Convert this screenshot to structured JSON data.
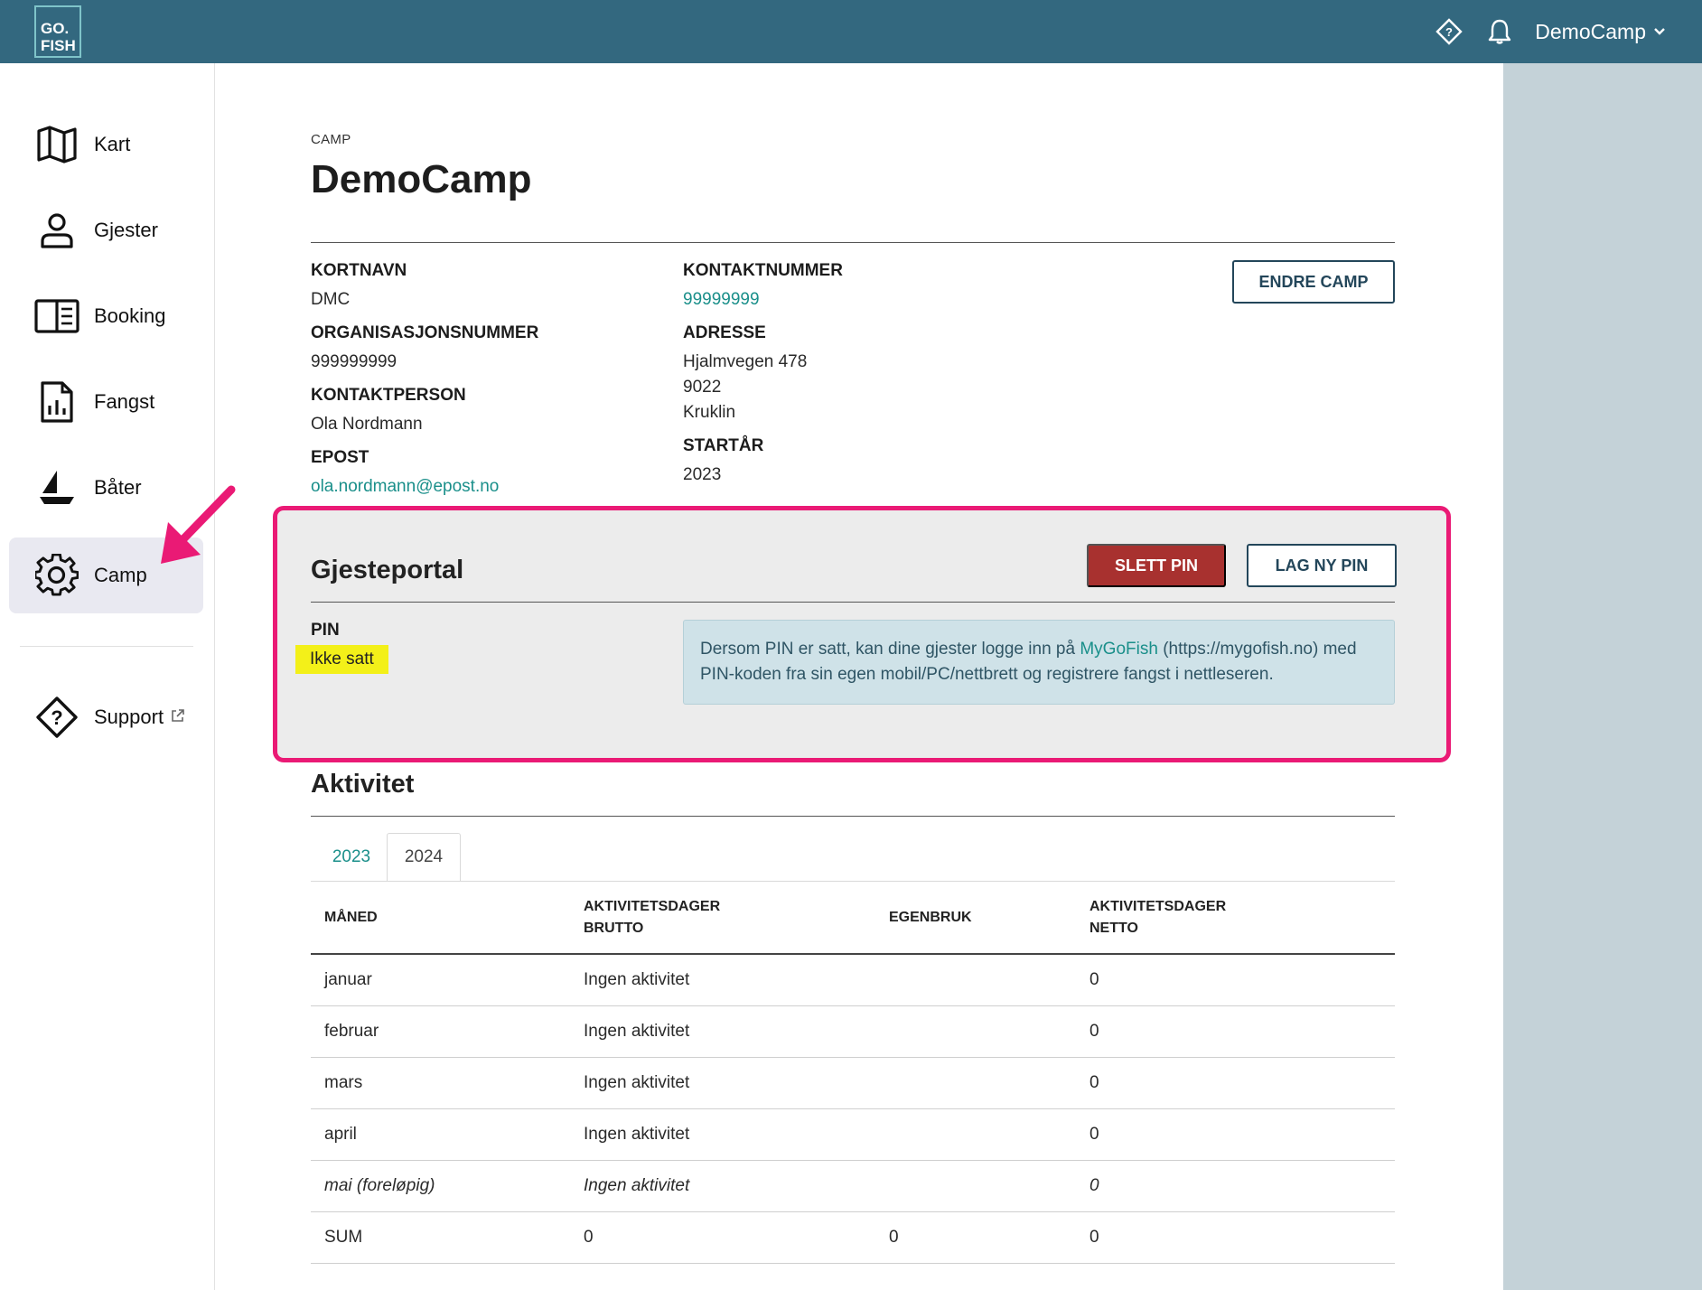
{
  "brand": {
    "logo_line1": "GO.",
    "logo_line2": "FISH"
  },
  "topbar": {
    "user_name": "DemoCamp",
    "support_icon": "diamond-question-icon",
    "bell_icon": "bell-icon",
    "chevron_icon": "chevron-down-icon"
  },
  "sidebar": {
    "items": [
      {
        "label": "Kart",
        "icon": "map-icon"
      },
      {
        "label": "Gjester",
        "icon": "person-icon"
      },
      {
        "label": "Booking",
        "icon": "book-icon"
      },
      {
        "label": "Fangst",
        "icon": "report-chart-icon"
      },
      {
        "label": "Båter",
        "icon": "boat-icon"
      },
      {
        "label": "Camp",
        "icon": "gear-icon",
        "active": true
      }
    ],
    "support": {
      "label": "Support",
      "icon": "diamond-question-icon",
      "external_icon": "external-link-icon"
    }
  },
  "page": {
    "eyebrow": "CAMP",
    "title": "DemoCamp"
  },
  "camp_info": {
    "kortnavn_label": "KORTNAVN",
    "kortnavn": "DMC",
    "orgnr_label": "ORGANISASJONSNUMMER",
    "orgnr": "999999999",
    "kontaktperson_label": "KONTAKTPERSON",
    "kontaktperson": "Ola Nordmann",
    "epost_label": "EPOST",
    "epost": "ola.nordmann@epost.no",
    "kontaktnummer_label": "KONTAKTNUMMER",
    "kontaktnummer": "99999999",
    "adresse_label": "ADRESSE",
    "adresse_line1": "Hjalmvegen 478",
    "adresse_line2": "9022",
    "adresse_line3": "Kruklin",
    "startaar_label": "STARTÅR",
    "startaar": "2023",
    "edit_button": "ENDRE CAMP"
  },
  "guest_portal": {
    "title": "Gjesteportal",
    "delete_pin_button": "SLETT PIN",
    "new_pin_button": "LAG NY PIN",
    "pin_label": "PIN",
    "pin_value": "Ikke satt",
    "info_text_before": "Dersom PIN er satt, kan dine gjester logge inn på ",
    "info_link": "MyGoFish",
    "info_text_after": " (https://mygofish.no) med PIN-koden fra sin egen mobil/PC/nettbrett og registrere fangst i nettleseren.",
    "highlight_color": "#ea1a75"
  },
  "activity": {
    "title": "Aktivitet",
    "tabs": [
      {
        "label": "2023"
      },
      {
        "label": "2024",
        "active": true
      }
    ],
    "columns": [
      "MÅNED",
      "AKTIVITETSDAGER BRUTTO",
      "EGENBRUK",
      "AKTIVITETSDAGER NETTO"
    ],
    "col_brutto_l1": "AKTIVITETSDAGER",
    "col_brutto_l2": "BRUTTO",
    "col_netto_l1": "AKTIVITETSDAGER",
    "col_netto_l2": "NETTO",
    "rows": [
      {
        "month": "januar",
        "brutto": "Ingen aktivitet",
        "egenbruk": "",
        "netto": "0"
      },
      {
        "month": "februar",
        "brutto": "Ingen aktivitet",
        "egenbruk": "",
        "netto": "0"
      },
      {
        "month": "mars",
        "brutto": "Ingen aktivitet",
        "egenbruk": "",
        "netto": "0"
      },
      {
        "month": "april",
        "brutto": "Ingen aktivitet",
        "egenbruk": "",
        "netto": "0"
      },
      {
        "month": "mai (foreløpig)",
        "brutto": "Ingen aktivitet",
        "egenbruk": "",
        "netto": "0"
      },
      {
        "month": "SUM",
        "brutto": "0",
        "egenbruk": "0",
        "netto": "0"
      }
    ]
  },
  "colors": {
    "topbar": "#33687f",
    "accent_link": "#1a8f8a",
    "danger": "#a8312f",
    "annotation": "#ea1a75",
    "pin_highlight": "#f3f019"
  }
}
